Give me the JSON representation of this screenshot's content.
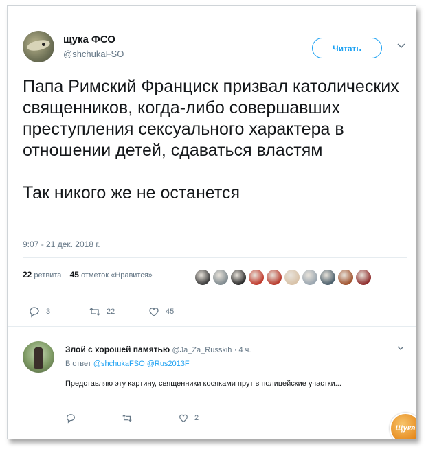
{
  "author": {
    "display_name": "щука ФСО",
    "handle": "@shchukaFSO",
    "follow_label": "Читать"
  },
  "tweet": {
    "paragraph1": "Папа Римский Франциск призвал католических священников, когда-либо совершавших преступления сексуального характера в отношении детей, сдаваться властям",
    "paragraph2": "Так никого же не останется",
    "timestamp": "9:07 - 21 дек. 2018 г."
  },
  "stats": {
    "retweets_count": "22",
    "retweets_label": "ретвита",
    "likes_count": "45",
    "likes_label": "отметок «Нравится»",
    "liker_avatar_colors": [
      "#3b3b3b",
      "#7f8a8f",
      "#2a2a2a",
      "#c0392b",
      "#b83a2c",
      "#d8c2a8",
      "#9aa6b0",
      "#4b5f6b",
      "#a0522d",
      "#8e2b2b"
    ]
  },
  "actions": {
    "reply_count": "3",
    "retweet_count": "22",
    "like_count": "45"
  },
  "reply": {
    "display_name": "Злой с хорошей памятью",
    "handle": "@Ja_Za_Russkih",
    "time": "· 4 ч.",
    "in_reply_label": "В ответ",
    "mention1": "@shchukaFSO",
    "mention2": "@Rus2013F",
    "text": "Представляю эту картину, священники косяками прут в полицейские участки...",
    "reply_count": "",
    "retweet_count": "",
    "like_count": "2"
  },
  "watermark_text": "Щука"
}
